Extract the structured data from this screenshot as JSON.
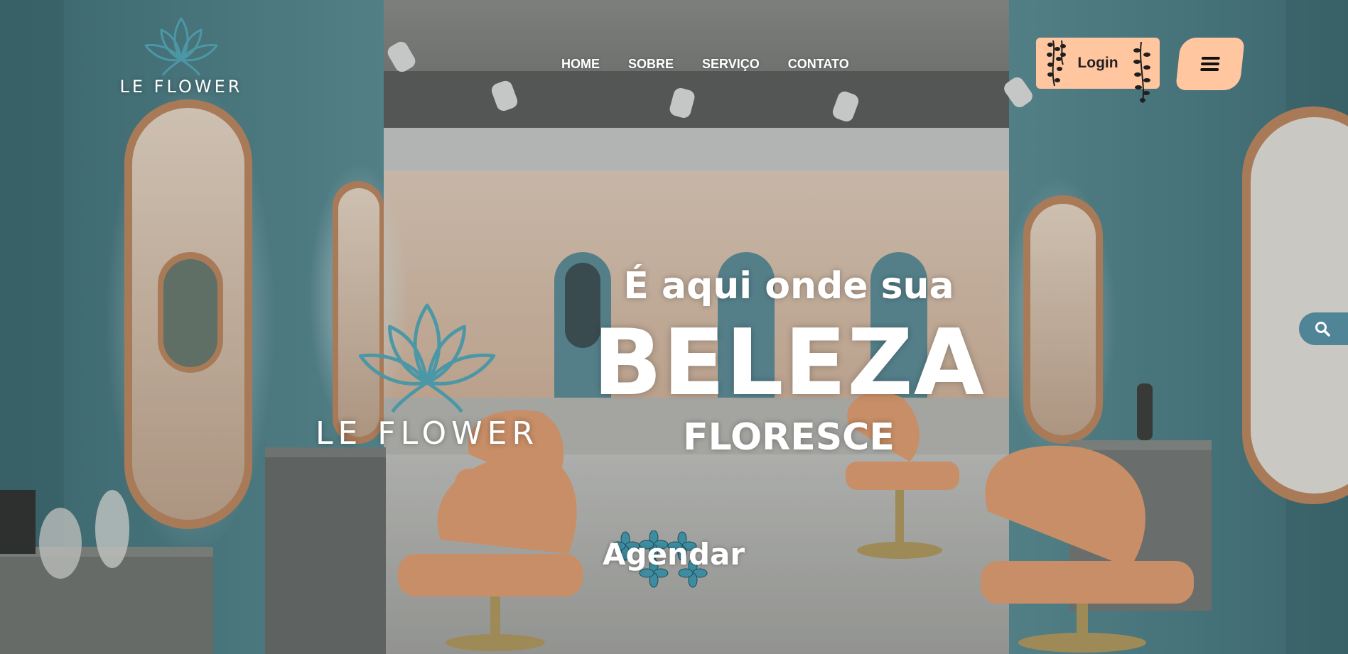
{
  "brand": {
    "name": "LE FLOWER",
    "accent_color": "#4c97a6",
    "button_color": "#ffc6a0"
  },
  "nav": {
    "items": [
      {
        "label": "HOME"
      },
      {
        "label": "SOBRE"
      },
      {
        "label": "SERVIÇO"
      },
      {
        "label": "CONTATO"
      }
    ]
  },
  "header": {
    "login_label": "Login",
    "menu_icon": "hamburger-icon"
  },
  "search": {
    "icon": "search-icon"
  },
  "hero": {
    "logo_name": "LE FLOWER",
    "kicker": "É aqui onde sua",
    "title": "BELEZA",
    "subtitle": "FLORESCE",
    "cta_label": "Agendar"
  }
}
